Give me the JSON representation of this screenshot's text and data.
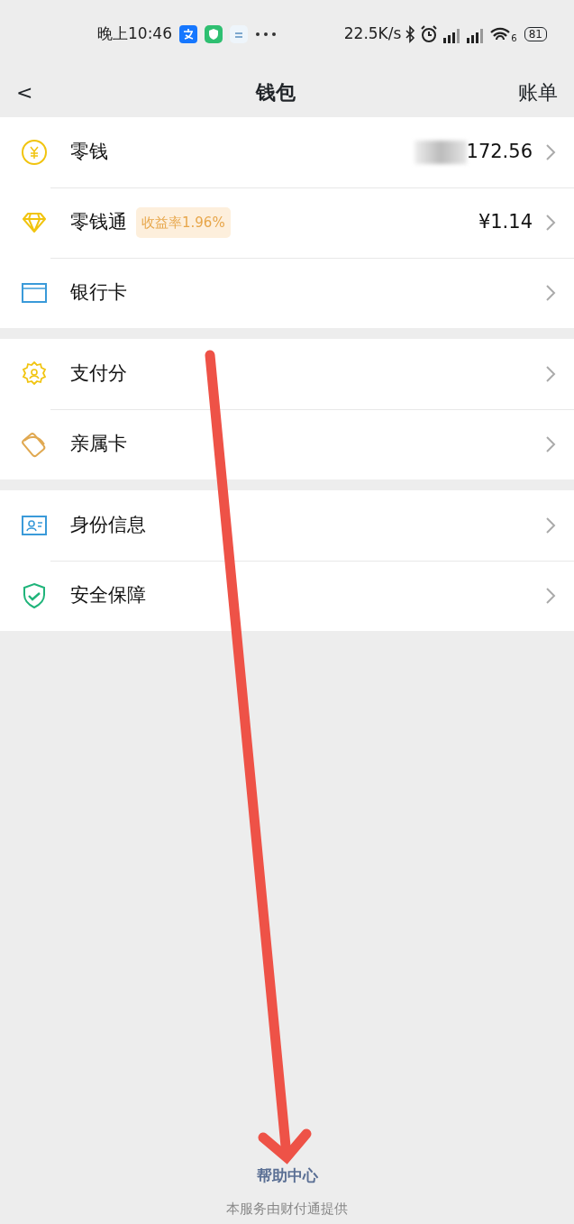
{
  "status_bar": {
    "time": "晚上10:46",
    "speed": "22.5K/s",
    "battery": "81",
    "wifi_sub": "6"
  },
  "nav": {
    "back": "<",
    "title": "钱包",
    "action": "账单"
  },
  "groups": [
    {
      "items": [
        {
          "kind": "yen",
          "label": "零钱",
          "value": "172.56",
          "redacted": true
        },
        {
          "kind": "diamond",
          "label": "零钱通",
          "tag": "收益率1.96%",
          "value": "¥1.14",
          "redacted": false
        },
        {
          "kind": "card",
          "label": "银行卡",
          "redacted": false
        }
      ]
    },
    {
      "items": [
        {
          "kind": "badge",
          "label": "支付分",
          "redacted": false
        },
        {
          "kind": "cards",
          "label": "亲属卡",
          "redacted": false
        }
      ]
    },
    {
      "items": [
        {
          "kind": "id",
          "label": "身份信息",
          "redacted": false
        },
        {
          "kind": "shield",
          "label": "安全保障",
          "redacted": false
        }
      ]
    }
  ],
  "footer": {
    "help": "帮助中心",
    "note": "本服务由财付通提供"
  },
  "annotation": {
    "kind": "arrow"
  }
}
